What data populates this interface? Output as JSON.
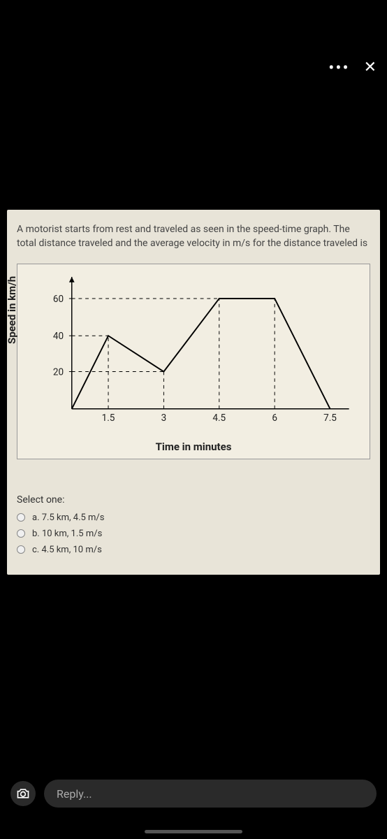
{
  "topbar": {
    "more_icon": "•••",
    "close_icon": "✕"
  },
  "question": {
    "text": "A motorist starts from rest and traveled as seen in the speed-time graph. The total distance traveled and the average velocity in m/s for the distance traveled is"
  },
  "chart_data": {
    "type": "line",
    "xlabel": "Time in minutes",
    "ylabel": "Speed in km/h",
    "x_ticks": [
      1.5,
      3.0,
      4.5,
      6.0,
      7.5
    ],
    "y_ticks": [
      20,
      40,
      60
    ],
    "xlim": [
      0,
      7.5
    ],
    "ylim": [
      0,
      65
    ],
    "series": [
      {
        "name": "speed",
        "points": [
          {
            "x": 0,
            "y": 0
          },
          {
            "x": 1.5,
            "y": 40
          },
          {
            "x": 3.0,
            "y": 20
          },
          {
            "x": 4.5,
            "y": 60
          },
          {
            "x": 6.0,
            "y": 60
          },
          {
            "x": 7.5,
            "y": 0
          }
        ]
      }
    ],
    "dashed_guides": [
      {
        "type": "horizontal",
        "y": 60,
        "x_end": 4.5
      },
      {
        "type": "horizontal",
        "y": 40,
        "x_end": 1.5
      },
      {
        "type": "horizontal",
        "y": 20,
        "x_end": 3.0
      },
      {
        "type": "vertical",
        "x": 1.5,
        "y_end": 40
      },
      {
        "type": "vertical",
        "x": 3.0,
        "y_end": 20
      },
      {
        "type": "vertical",
        "x": 4.5,
        "y_end": 60
      },
      {
        "type": "vertical",
        "x": 6.0,
        "y_end": 60
      }
    ]
  },
  "select": {
    "label": "Select one:",
    "options": [
      "a. 7.5 km,  4.5 m/s",
      "b. 10 km, 1.5 m/s",
      "c. 4.5 km, 10 m/s"
    ]
  },
  "reply": {
    "placeholder": "Reply..."
  }
}
